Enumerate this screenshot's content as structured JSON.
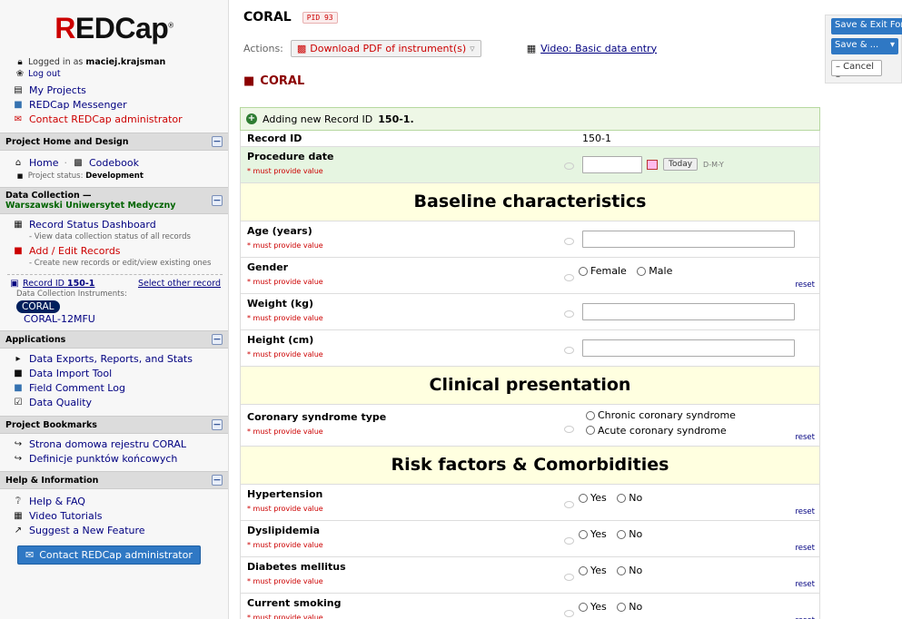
{
  "sidebar": {
    "logo": "REDCap",
    "logged_in_prefix": "Logged in as",
    "username": "maciej.krajsman",
    "logout": "Log out",
    "top_links": [
      "My Projects",
      "REDCap Messenger",
      "Contact REDCap administrator"
    ],
    "project_home_header": "Project Home and Design",
    "home": "Home",
    "codebook": "Codebook",
    "project_status_label": "Project status:",
    "project_status": "Development",
    "data_collection_header": "Data Collection —",
    "institution": "Warszawski Uniwersytet Medyczny",
    "record_status_dashboard": "Record Status Dashboard",
    "record_status_desc": "- View data collection status of all records",
    "add_edit_records": "Add / Edit Records",
    "add_edit_desc": "- Create new records or edit/view existing ones",
    "record_id_label": "Record ID",
    "record_id": "150-1",
    "select_other": "Select other record",
    "instruments_label": "Data Collection Instruments:",
    "instruments": [
      "CORAL",
      "CORAL-12MFU"
    ],
    "applications_header": "Applications",
    "applications": [
      "Data Exports, Reports, and Stats",
      "Data Import Tool",
      "Field Comment Log",
      "Data Quality"
    ],
    "bookmarks_header": "Project Bookmarks",
    "bookmarks": [
      "Strona domowa rejestru CORAL",
      "Definicje punktów końcowych"
    ],
    "help_header": "Help & Information",
    "help_links": [
      "Help & FAQ",
      "Video Tutorials",
      "Suggest a New Feature"
    ],
    "contact_button": "Contact REDCap administrator"
  },
  "main": {
    "project_title": "CORAL",
    "pid": "PID 93",
    "actions_label": "Actions:",
    "pdf_button": "Download PDF of instrument(s)",
    "video_link": "Video: Basic data entry",
    "form_title": "CORAL",
    "adding_prefix": "Adding new Record ID",
    "adding_id": "150-1.",
    "required_text": "* must provide value",
    "reset": "reset",
    "record_id_label": "Record ID",
    "record_id_value": "150-1",
    "procedure_date": "Procedure date",
    "today": "Today",
    "date_format": "D-M-Y",
    "section_baseline": "Baseline characteristics",
    "age": "Age (years)",
    "gender": "Gender",
    "gender_options": [
      "Female",
      "Male"
    ],
    "weight": "Weight (kg)",
    "height": "Height (cm)",
    "section_clinical": "Clinical presentation",
    "coronary": "Coronary syndrome type",
    "coronary_options": [
      "Chronic coronary syndrome",
      "Acute coronary syndrome"
    ],
    "section_risk": "Risk factors & Comorbidities",
    "yes": "Yes",
    "no": "No",
    "hypertension": "Hypertension",
    "dyslipidemia": "Dyslipidemia",
    "diabetes": "Diabetes mellitus",
    "smoking": "Current smoking"
  },
  "float_panel": {
    "save_exit": "Save & Exit Form",
    "save_more": "Save & ...",
    "cancel": "– Cancel –"
  }
}
